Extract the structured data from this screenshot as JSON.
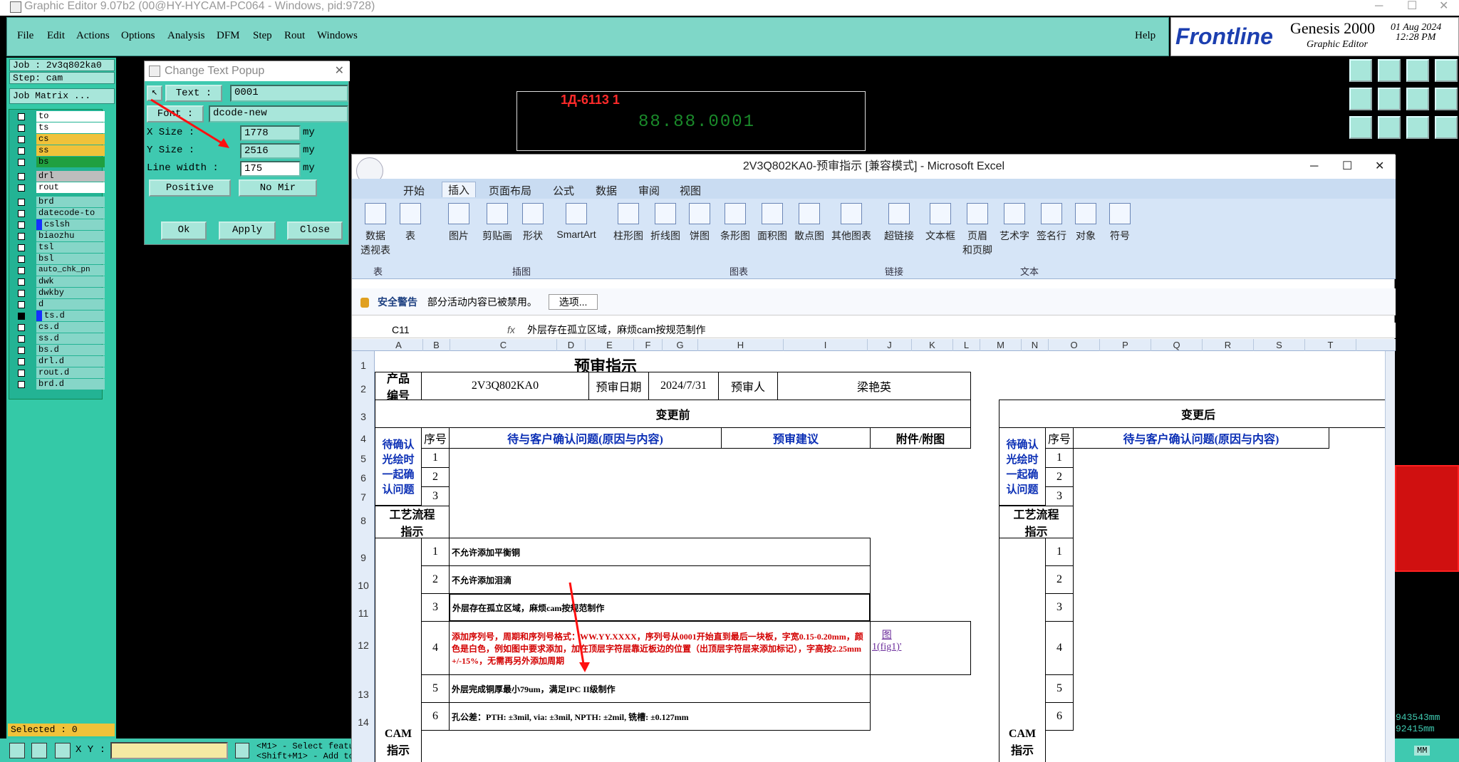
{
  "ge": {
    "title": "Graphic Editor 9.07b2 (00@HY-HYCAM-PC064 - Windows, pid:9728)",
    "menu": [
      "File",
      "Edit",
      "Actions",
      "Options",
      "Analysis",
      "DFM",
      "Step",
      "Rout",
      "Windows"
    ],
    "help": "Help",
    "brand": "Frontline",
    "product": "Genesis 2000",
    "product_sub": "Graphic Editor",
    "date": "01 Aug 2024",
    "time": "12:28 PM",
    "job_label": "Job : 2v3q802ka0",
    "step_label": "Step: cam",
    "job_matrix": "Job Matrix ...",
    "layers": [
      "to",
      "ts",
      "cs",
      "ss",
      "bs",
      "drl",
      "rout",
      "brd",
      "datecode-to",
      "cslsh",
      "biaozhu",
      "tsl",
      "bsl",
      "auto_chk_pn",
      "dwk",
      "dwkby",
      "d",
      "ts.d",
      "cs.d",
      "ss.d",
      "bs.d",
      "drl.d",
      "rout.d",
      "brd.d"
    ],
    "selected": "Selected : 0",
    "xy_label": "X Y :",
    "hint1": "<M1> - Select featu",
    "hint2": "<Shift+M1> - Add to",
    "coord1": "943543mm",
    "coord2": "92415mm",
    "units": "MM",
    "canvas_text1": "1Д-6113 1",
    "canvas_text2": "88.88.0001"
  },
  "popup": {
    "title": "Change Text Popup",
    "text_btn": "Text  :",
    "text_value": "0001",
    "font_btn": "Font  :",
    "font_value": "dcode-new",
    "xsize_label": "X Size     :",
    "xsize_value": "1778",
    "ysize_label": "Y Size     :",
    "ysize_value": "2516",
    "linewidth_label": "Line width  :",
    "linewidth_value": "175",
    "unit": "my",
    "polarity": "Positive",
    "mirror": "No Mir",
    "ok": "Ok",
    "apply": "Apply",
    "close": "Close"
  },
  "excel": {
    "title": "2V3Q802KA0-预审指示  [兼容模式] - Microsoft Excel",
    "tabs": [
      "开始",
      "插入",
      "页面布局",
      "公式",
      "数据",
      "审阅",
      "视图"
    ],
    "ribbon": [
      {
        "label": "数据\n透视表",
        "group": "表"
      },
      {
        "label": "表",
        "group": "表"
      },
      {
        "label": "图片",
        "group": "插图"
      },
      {
        "label": "剪贴画",
        "group": "插图"
      },
      {
        "label": "形状",
        "group": "插图"
      },
      {
        "label": "SmartArt",
        "group": "插图"
      },
      {
        "label": "柱形图",
        "group": "图表"
      },
      {
        "label": "折线图",
        "group": "图表"
      },
      {
        "label": "饼图",
        "group": "图表"
      },
      {
        "label": "条形图",
        "group": "图表"
      },
      {
        "label": "面积图",
        "group": "图表"
      },
      {
        "label": "散点图",
        "group": "图表"
      },
      {
        "label": "其他图表",
        "group": "图表"
      },
      {
        "label": "超链接",
        "group": "链接"
      },
      {
        "label": "文本框",
        "group": "文本"
      },
      {
        "label": "页眉\n和页脚",
        "group": "文本"
      },
      {
        "label": "艺术字",
        "group": "文本"
      },
      {
        "label": "签名行",
        "group": "文本"
      },
      {
        "label": "对象",
        "group": "文本"
      },
      {
        "label": "符号",
        "group": "文本"
      }
    ],
    "groups": [
      "表",
      "插图",
      "图表",
      "链接",
      "文本"
    ],
    "security_title": "安全警告",
    "security_msg": "部分活动内容已被禁用。",
    "options_btn": "选项...",
    "namebox": "C11",
    "fx": "fx",
    "formula": "外层存在孤立区域，麻烦cam按规范制作",
    "columns": [
      "A",
      "B",
      "C",
      "D",
      "E",
      "F",
      "G",
      "H",
      "I",
      "J",
      "K",
      "L",
      "M",
      "N",
      "O",
      "P",
      "Q",
      "R",
      "S",
      "T"
    ],
    "rows": [
      "1",
      "2",
      "3",
      "4",
      "5",
      "6",
      "7",
      "8",
      "9",
      "10",
      "11",
      "12",
      "13",
      "14"
    ],
    "sheet": {
      "title": "预审指示",
      "product_no_label": "产品\n编号",
      "product_no": "2V3Q802KA0",
      "review_date_label": "预审日期",
      "review_date": "2024/7/31",
      "reviewer_label": "预审人",
      "reviewer": "梁艳英",
      "before": "变更前",
      "after": "变更后",
      "seq": "序号",
      "issue_hdr": "待与客户确认问题(原因与内容)",
      "advice_hdr": "预审建议",
      "attach_hdr": "附件/附图",
      "pending_label": "待确认\n光绘时\n一起确\n认问题",
      "process_label": "工艺流程\n指示",
      "cam_label": "CAM\n指示",
      "items": [
        {
          "n": "1",
          "text": "不允许添加平衡铜"
        },
        {
          "n": "2",
          "text": "不允许添加泪滴"
        },
        {
          "n": "3",
          "text": "外层存在孤立区域，麻烦cam按规范制作"
        },
        {
          "n": "4",
          "text": "添加序列号，周期和序列号格式：WW.YY.XXXX，序列号从0001开始直到最后一块板，字宽0.15-0.20mm，颜色是白色，例如图中要求添加，加在顶层字符层靠近板边的位置（出顶层字符层来添加标记），字高按2.25mm +/-15%，无需再另外添加周期"
        },
        {
          "n": "5",
          "text": "外层完成铜厚最小79um，满足IPC II级制作"
        },
        {
          "n": "6",
          "text": "孔公差：PTH: ±3mil,  via: ±3mil,  NPTH: ±2mil,  铣槽: ±0.127mm"
        }
      ],
      "fig_link": "图\n1(fig1)'"
    }
  }
}
